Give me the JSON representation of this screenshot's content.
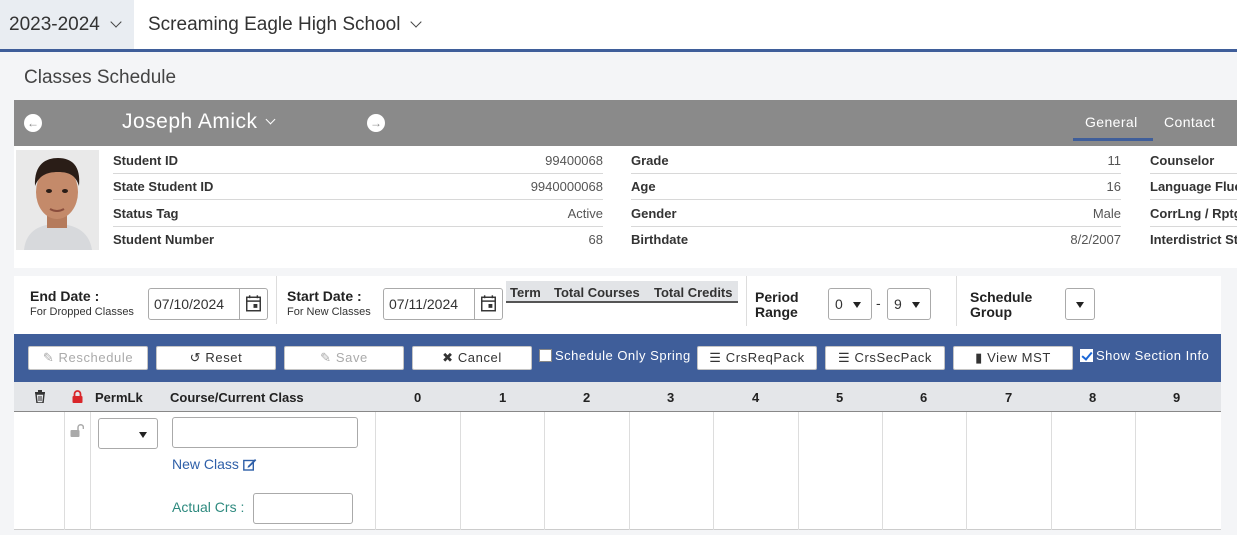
{
  "topbar": {
    "year": "2023-2024",
    "school": "Screaming Eagle High School"
  },
  "page": {
    "title": "Classes Schedule"
  },
  "student": {
    "name": "Joseph Amick",
    "tabs": [
      "General",
      "Contact"
    ],
    "active_tab": "General",
    "col1": [
      {
        "label": "Student ID",
        "value": "99400068"
      },
      {
        "label": "State Student ID",
        "value": "9940000068"
      },
      {
        "label": "Status Tag",
        "value": "Active"
      },
      {
        "label": "Student Number",
        "value": "68"
      }
    ],
    "col2": [
      {
        "label": "Grade",
        "value": "11"
      },
      {
        "label": "Age",
        "value": "16"
      },
      {
        "label": "Gender",
        "value": "Male"
      },
      {
        "label": "Birthdate",
        "value": "8/2/2007"
      }
    ],
    "col3": [
      {
        "label": "Counselor"
      },
      {
        "label": "Language Flue"
      },
      {
        "label": "CorrLng / Rptg"
      },
      {
        "label": "Interdistrict St"
      }
    ]
  },
  "filters": {
    "end_date_label": "End Date :",
    "end_date_sub": "For Dropped Classes",
    "end_date": "07/10/2024",
    "start_date_label": "Start Date :",
    "start_date_sub": "For New Classes",
    "start_date": "07/11/2024",
    "term_headers": [
      "Term",
      "Total Courses",
      "Total Credits"
    ],
    "period_range_label_1": "Period",
    "period_range_label_2": "Range",
    "period_from": "0",
    "period_sep": "-",
    "period_to": "9",
    "schedule_group_label_1": "Schedule",
    "schedule_group_label_2": "Group"
  },
  "actions": {
    "reschedule": "Reschedule",
    "reset": "Reset",
    "save": "Save",
    "cancel": "Cancel",
    "schedule_only_spring": "Schedule Only Spring",
    "crsreqpack": "CrsReqPack",
    "crssecpack": "CrsSecPack",
    "view_mst": "View MST",
    "show_section_info": "Show Section Info"
  },
  "grid": {
    "permlk": "PermLk",
    "course": "Course/Current Class",
    "periods": [
      "0",
      "1",
      "2",
      "3",
      "4",
      "5",
      "6",
      "7",
      "8",
      "9"
    ],
    "new_class": "New Class",
    "actual_crs": "Actual Crs :"
  },
  "colors": {
    "accent": "#3f5e9a",
    "header_gray": "#8a8a8a",
    "lock_red": "#d9262a"
  }
}
